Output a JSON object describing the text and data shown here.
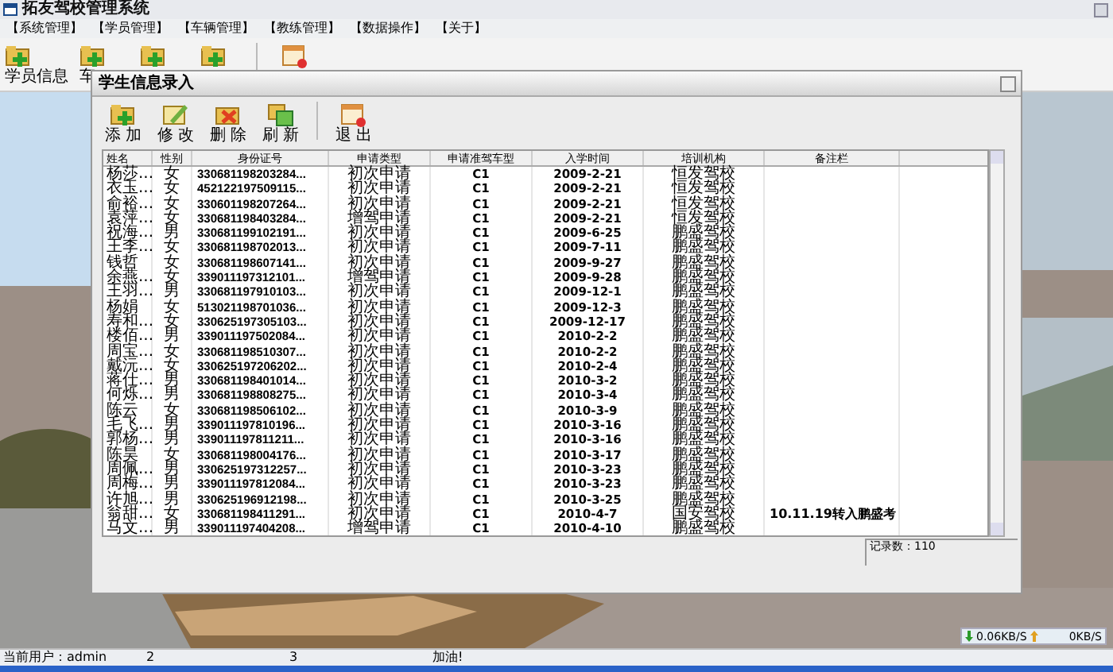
{
  "app": {
    "title": "拓友驾校管理系统"
  },
  "menu": [
    "【系统管理】",
    "【学员管理】",
    "【车辆管理】",
    "【教练管理】",
    "【数据操作】",
    "【关于】"
  ],
  "main_toolbar": [
    {
      "kind": "add",
      "label": "学员信息"
    },
    {
      "kind": "add",
      "label": "车"
    },
    {
      "kind": "add"
    },
    {
      "kind": "add"
    },
    {
      "kind": "exit"
    }
  ],
  "child_window": {
    "title": "学生信息录入",
    "toolbar": [
      {
        "kind": "add",
        "label": "添 加"
      },
      {
        "kind": "edit",
        "label": "修 改"
      },
      {
        "kind": "delete",
        "label": "删 除"
      },
      {
        "kind": "refresh",
        "label": "刷 新"
      },
      {
        "kind": "exit",
        "label": "退 出"
      }
    ],
    "table": {
      "columns": [
        "姓名",
        "性别",
        "身份证号",
        "申请类型",
        "申请准驾车型",
        "入学时间",
        "培训机构",
        "备注栏"
      ],
      "rows": [
        [
          "杨莎...",
          "女",
          "330681198203284...",
          "初次申请",
          "C1",
          "2009-2-21",
          "恒发驾校",
          ""
        ],
        [
          "衣玉...",
          "女",
          "452122197509115...",
          "初次申请",
          "C1",
          "2009-2-21",
          "恒发驾校",
          ""
        ],
        [
          "俞裕...",
          "女",
          "330601198207264...",
          "初次申请",
          "C1",
          "2009-2-21",
          "恒发驾校",
          ""
        ],
        [
          "袁萍...",
          "女",
          "330681198403284...",
          "增驾申请",
          "C1",
          "2009-2-21",
          "恒发驾校",
          ""
        ],
        [
          "祝海...",
          "男",
          "330681199102191...",
          "初次申请",
          "C1",
          "2009-6-25",
          "鹏盛驾校",
          ""
        ],
        [
          "王李...",
          "女",
          "330681198702013...",
          "初次申请",
          "C1",
          "2009-7-11",
          "鹏盛驾校",
          ""
        ],
        [
          "钱哲",
          "女",
          "330681198607141...",
          "初次申请",
          "C1",
          "2009-9-27",
          "鹏盛驾校",
          ""
        ],
        [
          "余燕...",
          "女",
          "339011197312101...",
          "增驾申请",
          "C1",
          "2009-9-28",
          "鹏盛驾校",
          ""
        ],
        [
          "王羽...",
          "男",
          "330681197910103...",
          "初次申请",
          "C1",
          "2009-12-1",
          "鹏盛驾校",
          ""
        ],
        [
          "杨娟",
          "女",
          "513021198701036...",
          "初次申请",
          "C1",
          "2009-12-3",
          "鹏盛驾校",
          ""
        ],
        [
          "寿和...",
          "女",
          "330625197305103...",
          "初次申请",
          "C1",
          "2009-12-17",
          "鹏盛驾校",
          ""
        ],
        [
          "楼佰...",
          "男",
          "339011197502084...",
          "初次申请",
          "C1",
          "2010-2-2",
          "鹏盛驾校",
          ""
        ],
        [
          "周宝...",
          "女",
          "330681198510307...",
          "初次申请",
          "C1",
          "2010-2-2",
          "鹏盛驾校",
          ""
        ],
        [
          "戴沅...",
          "女",
          "330625197206202...",
          "初次申请",
          "C1",
          "2010-2-4",
          "鹏盛驾校",
          ""
        ],
        [
          "蒋仕...",
          "男",
          "330681198401014...",
          "初次申请",
          "C1",
          "2010-3-2",
          "鹏盛驾校",
          ""
        ],
        [
          "何烁...",
          "男",
          "330681198808275...",
          "初次申请",
          "C1",
          "2010-3-4",
          "鹏盛驾校",
          ""
        ],
        [
          "陈云",
          "女",
          "330681198506102...",
          "初次申请",
          "C1",
          "2010-3-9",
          "鹏盛驾校",
          ""
        ],
        [
          "毛飞...",
          "男",
          "339011197810196...",
          "初次申请",
          "C1",
          "2010-3-16",
          "鹏盛驾校",
          ""
        ],
        [
          "郭杨...",
          "男",
          "339011197811211...",
          "初次申请",
          "C1",
          "2010-3-16",
          "鹏盛驾校",
          ""
        ],
        [
          "陈昊",
          "女",
          "330681198004176...",
          "初次申请",
          "C1",
          "2010-3-17",
          "鹏盛驾校",
          ""
        ],
        [
          "周佩...",
          "男",
          "330625197312257...",
          "初次申请",
          "C1",
          "2010-3-23",
          "鹏盛驾校",
          ""
        ],
        [
          "周梅...",
          "男",
          "339011197812084...",
          "初次申请",
          "C1",
          "2010-3-23",
          "鹏盛驾校",
          ""
        ],
        [
          "许旭...",
          "男",
          "330625196912198...",
          "初次申请",
          "C1",
          "2010-3-25",
          "鹏盛驾校",
          ""
        ],
        [
          "翁甜...",
          "女",
          "330681198411291...",
          "初次申请",
          "C1",
          "2010-4-7",
          "国安驾校",
          "10.11.19转入鹏盛考"
        ],
        [
          "马文...",
          "男",
          "339011197404208...",
          "增驾申请",
          "C1",
          "2010-4-10",
          "鹏盛驾校",
          ""
        ]
      ]
    },
    "record_count": "记录数：110"
  },
  "network": {
    "down": "0.06KB/S",
    "up": "0KB/S"
  },
  "status_bar": [
    "当前用户：admin",
    "2",
    "3",
    "加油!"
  ]
}
